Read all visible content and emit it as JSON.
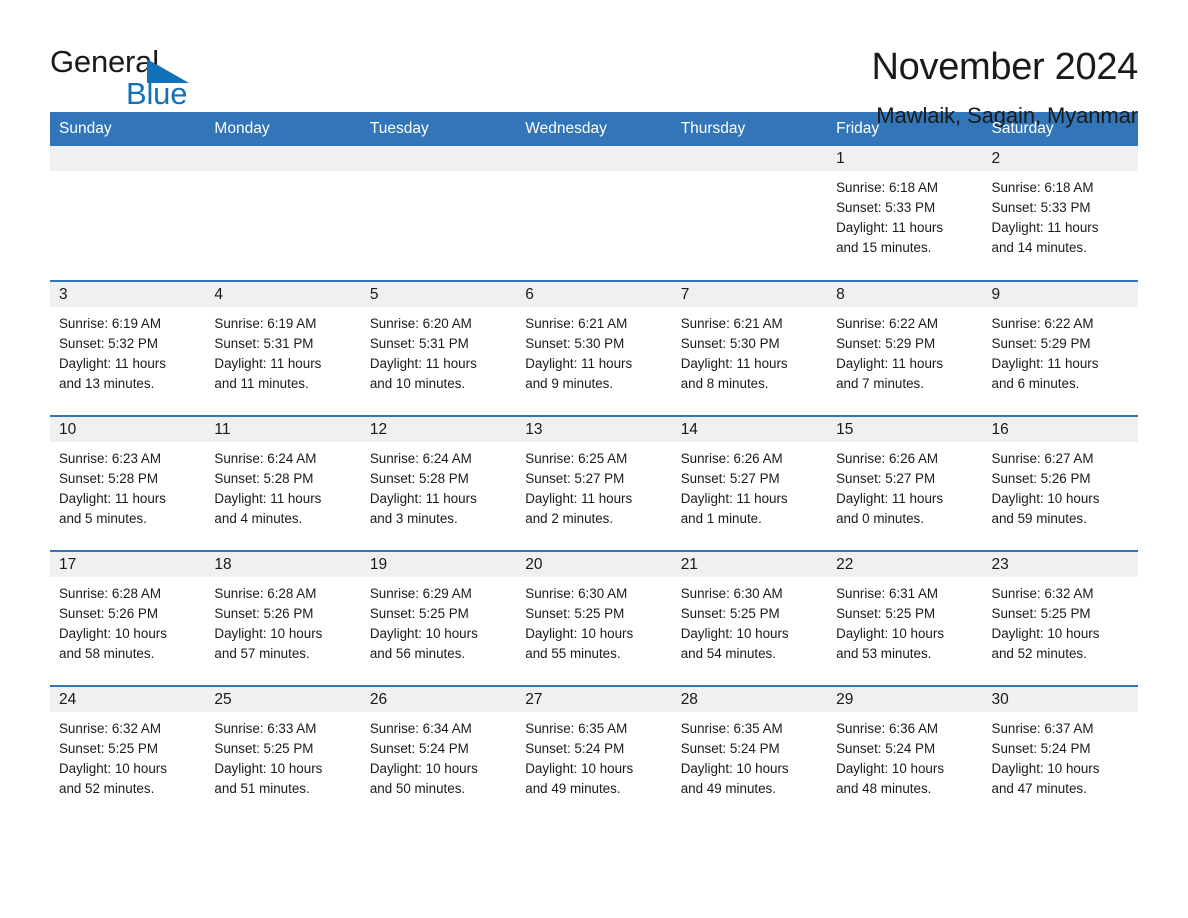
{
  "logo": {
    "word1": "General",
    "word2": "Blue",
    "triangle_color": "#1270b8"
  },
  "header": {
    "title": "November 2024",
    "subtitle": "Mawlaik, Sagain, Myanmar",
    "accent_color": "#3275b8",
    "daynum_band_color": "#f0f0f0"
  },
  "calendar": {
    "weekday_headers": [
      "Sunday",
      "Monday",
      "Tuesday",
      "Wednesday",
      "Thursday",
      "Friday",
      "Saturday"
    ],
    "weeks": [
      [
        {
          "day": "",
          "empty": true
        },
        {
          "day": "",
          "empty": true
        },
        {
          "day": "",
          "empty": true
        },
        {
          "day": "",
          "empty": true
        },
        {
          "day": "",
          "empty": true
        },
        {
          "day": "1",
          "sunrise": "Sunrise: 6:18 AM",
          "sunset": "Sunset: 5:33 PM",
          "daylight1": "Daylight: 11 hours",
          "daylight2": "and 15 minutes."
        },
        {
          "day": "2",
          "sunrise": "Sunrise: 6:18 AM",
          "sunset": "Sunset: 5:33 PM",
          "daylight1": "Daylight: 11 hours",
          "daylight2": "and 14 minutes."
        }
      ],
      [
        {
          "day": "3",
          "sunrise": "Sunrise: 6:19 AM",
          "sunset": "Sunset: 5:32 PM",
          "daylight1": "Daylight: 11 hours",
          "daylight2": "and 13 minutes."
        },
        {
          "day": "4",
          "sunrise": "Sunrise: 6:19 AM",
          "sunset": "Sunset: 5:31 PM",
          "daylight1": "Daylight: 11 hours",
          "daylight2": "and 11 minutes."
        },
        {
          "day": "5",
          "sunrise": "Sunrise: 6:20 AM",
          "sunset": "Sunset: 5:31 PM",
          "daylight1": "Daylight: 11 hours",
          "daylight2": "and 10 minutes."
        },
        {
          "day": "6",
          "sunrise": "Sunrise: 6:21 AM",
          "sunset": "Sunset: 5:30 PM",
          "daylight1": "Daylight: 11 hours",
          "daylight2": "and 9 minutes."
        },
        {
          "day": "7",
          "sunrise": "Sunrise: 6:21 AM",
          "sunset": "Sunset: 5:30 PM",
          "daylight1": "Daylight: 11 hours",
          "daylight2": "and 8 minutes."
        },
        {
          "day": "8",
          "sunrise": "Sunrise: 6:22 AM",
          "sunset": "Sunset: 5:29 PM",
          "daylight1": "Daylight: 11 hours",
          "daylight2": "and 7 minutes."
        },
        {
          "day": "9",
          "sunrise": "Sunrise: 6:22 AM",
          "sunset": "Sunset: 5:29 PM",
          "daylight1": "Daylight: 11 hours",
          "daylight2": "and 6 minutes."
        }
      ],
      [
        {
          "day": "10",
          "sunrise": "Sunrise: 6:23 AM",
          "sunset": "Sunset: 5:28 PM",
          "daylight1": "Daylight: 11 hours",
          "daylight2": "and 5 minutes."
        },
        {
          "day": "11",
          "sunrise": "Sunrise: 6:24 AM",
          "sunset": "Sunset: 5:28 PM",
          "daylight1": "Daylight: 11 hours",
          "daylight2": "and 4 minutes."
        },
        {
          "day": "12",
          "sunrise": "Sunrise: 6:24 AM",
          "sunset": "Sunset: 5:28 PM",
          "daylight1": "Daylight: 11 hours",
          "daylight2": "and 3 minutes."
        },
        {
          "day": "13",
          "sunrise": "Sunrise: 6:25 AM",
          "sunset": "Sunset: 5:27 PM",
          "daylight1": "Daylight: 11 hours",
          "daylight2": "and 2 minutes."
        },
        {
          "day": "14",
          "sunrise": "Sunrise: 6:26 AM",
          "sunset": "Sunset: 5:27 PM",
          "daylight1": "Daylight: 11 hours",
          "daylight2": "and 1 minute."
        },
        {
          "day": "15",
          "sunrise": "Sunrise: 6:26 AM",
          "sunset": "Sunset: 5:27 PM",
          "daylight1": "Daylight: 11 hours",
          "daylight2": "and 0 minutes."
        },
        {
          "day": "16",
          "sunrise": "Sunrise: 6:27 AM",
          "sunset": "Sunset: 5:26 PM",
          "daylight1": "Daylight: 10 hours",
          "daylight2": "and 59 minutes."
        }
      ],
      [
        {
          "day": "17",
          "sunrise": "Sunrise: 6:28 AM",
          "sunset": "Sunset: 5:26 PM",
          "daylight1": "Daylight: 10 hours",
          "daylight2": "and 58 minutes."
        },
        {
          "day": "18",
          "sunrise": "Sunrise: 6:28 AM",
          "sunset": "Sunset: 5:26 PM",
          "daylight1": "Daylight: 10 hours",
          "daylight2": "and 57 minutes."
        },
        {
          "day": "19",
          "sunrise": "Sunrise: 6:29 AM",
          "sunset": "Sunset: 5:25 PM",
          "daylight1": "Daylight: 10 hours",
          "daylight2": "and 56 minutes."
        },
        {
          "day": "20",
          "sunrise": "Sunrise: 6:30 AM",
          "sunset": "Sunset: 5:25 PM",
          "daylight1": "Daylight: 10 hours",
          "daylight2": "and 55 minutes."
        },
        {
          "day": "21",
          "sunrise": "Sunrise: 6:30 AM",
          "sunset": "Sunset: 5:25 PM",
          "daylight1": "Daylight: 10 hours",
          "daylight2": "and 54 minutes."
        },
        {
          "day": "22",
          "sunrise": "Sunrise: 6:31 AM",
          "sunset": "Sunset: 5:25 PM",
          "daylight1": "Daylight: 10 hours",
          "daylight2": "and 53 minutes."
        },
        {
          "day": "23",
          "sunrise": "Sunrise: 6:32 AM",
          "sunset": "Sunset: 5:25 PM",
          "daylight1": "Daylight: 10 hours",
          "daylight2": "and 52 minutes."
        }
      ],
      [
        {
          "day": "24",
          "sunrise": "Sunrise: 6:32 AM",
          "sunset": "Sunset: 5:25 PM",
          "daylight1": "Daylight: 10 hours",
          "daylight2": "and 52 minutes."
        },
        {
          "day": "25",
          "sunrise": "Sunrise: 6:33 AM",
          "sunset": "Sunset: 5:25 PM",
          "daylight1": "Daylight: 10 hours",
          "daylight2": "and 51 minutes."
        },
        {
          "day": "26",
          "sunrise": "Sunrise: 6:34 AM",
          "sunset": "Sunset: 5:24 PM",
          "daylight1": "Daylight: 10 hours",
          "daylight2": "and 50 minutes."
        },
        {
          "day": "27",
          "sunrise": "Sunrise: 6:35 AM",
          "sunset": "Sunset: 5:24 PM",
          "daylight1": "Daylight: 10 hours",
          "daylight2": "and 49 minutes."
        },
        {
          "day": "28",
          "sunrise": "Sunrise: 6:35 AM",
          "sunset": "Sunset: 5:24 PM",
          "daylight1": "Daylight: 10 hours",
          "daylight2": "and 49 minutes."
        },
        {
          "day": "29",
          "sunrise": "Sunrise: 6:36 AM",
          "sunset": "Sunset: 5:24 PM",
          "daylight1": "Daylight: 10 hours",
          "daylight2": "and 48 minutes."
        },
        {
          "day": "30",
          "sunrise": "Sunrise: 6:37 AM",
          "sunset": "Sunset: 5:24 PM",
          "daylight1": "Daylight: 10 hours",
          "daylight2": "and 47 minutes."
        }
      ]
    ]
  }
}
